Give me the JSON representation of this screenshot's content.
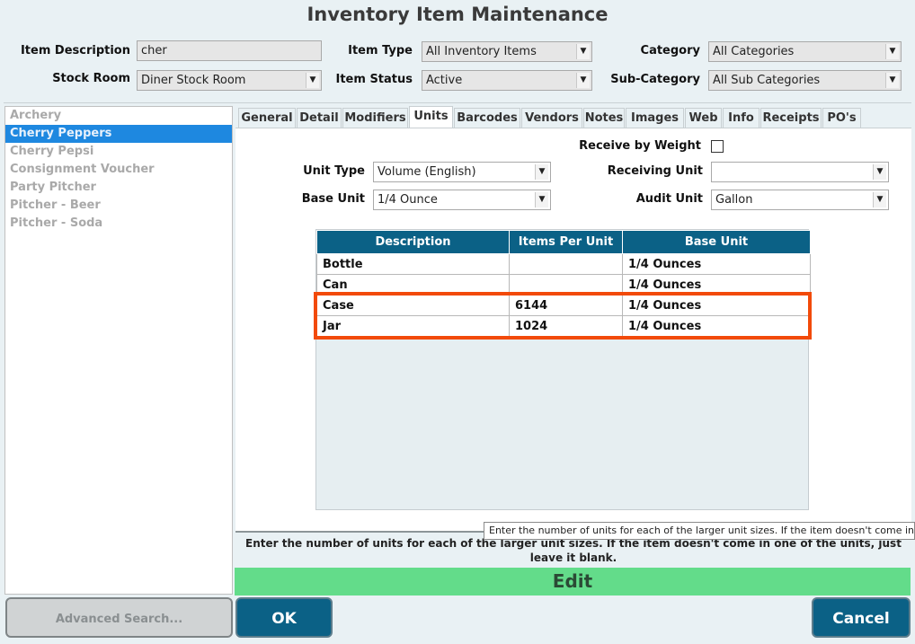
{
  "window": {
    "title": "Inventory Item Maintenance"
  },
  "filters": {
    "item_description_label": "Item Description",
    "item_description_value": "cher",
    "stock_room_label": "Stock Room",
    "stock_room_value": "Diner Stock Room",
    "item_type_label": "Item Type",
    "item_type_value": "All Inventory Items",
    "item_status_label": "Item Status",
    "item_status_value": "Active",
    "category_label": "Category",
    "category_value": "All Categories",
    "sub_category_label": "Sub-Category",
    "sub_category_value": "All Sub Categories"
  },
  "item_list": [
    {
      "label": "Archery",
      "selected": false
    },
    {
      "label": "Cherry Peppers",
      "selected": true
    },
    {
      "label": "Cherry Pepsi",
      "selected": false
    },
    {
      "label": "Consignment Voucher",
      "selected": false
    },
    {
      "label": "Party Pitcher",
      "selected": false
    },
    {
      "label": "Pitcher - Beer",
      "selected": false
    },
    {
      "label": "Pitcher - Soda",
      "selected": false
    }
  ],
  "tabs": [
    {
      "label": "General"
    },
    {
      "label": "Detail"
    },
    {
      "label": "Modifiers"
    },
    {
      "label": "Units",
      "active": true
    },
    {
      "label": "Barcodes"
    },
    {
      "label": "Vendors"
    },
    {
      "label": "Notes"
    },
    {
      "label": "Images"
    },
    {
      "label": "Web"
    },
    {
      "label": "Info"
    },
    {
      "label": "Receipts"
    },
    {
      "label": "PO's"
    }
  ],
  "units": {
    "receive_by_weight_label": "Receive by Weight",
    "receive_by_weight_checked": false,
    "unit_type_label": "Unit Type",
    "unit_type_value": "Volume (English)",
    "base_unit_label": "Base Unit",
    "base_unit_value": "1/4 Ounce",
    "receiving_unit_label": "Receiving Unit",
    "receiving_unit_value": "",
    "audit_unit_label": "Audit Unit",
    "audit_unit_value": "Gallon",
    "table": {
      "headers": [
        "Description",
        "Items Per Unit",
        "Base Unit"
      ],
      "rows": [
        [
          "Bottle",
          "",
          "1/4 Ounces"
        ],
        [
          "Can",
          "",
          "1/4 Ounces"
        ],
        [
          "Case",
          "6144",
          "1/4 Ounces"
        ],
        [
          "Jar",
          "1024",
          "1/4 Ounces"
        ]
      ]
    }
  },
  "tooltip": "Enter the number of units for each of the larger unit sizes.  If the item doesn't come in one",
  "help_text": "Enter the number of units for each of the larger unit sizes.  If the item doesn't come in one of the units, just leave it blank.",
  "edit_label": "Edit",
  "buttons": {
    "advanced_search": "Advanced Search...",
    "ok": "OK",
    "cancel": "Cancel"
  },
  "colors": {
    "header_blue": "#0b6186",
    "selection_blue": "#1e88e0",
    "edit_green": "#63dc8a",
    "highlight_orange": "#f24a0a"
  }
}
